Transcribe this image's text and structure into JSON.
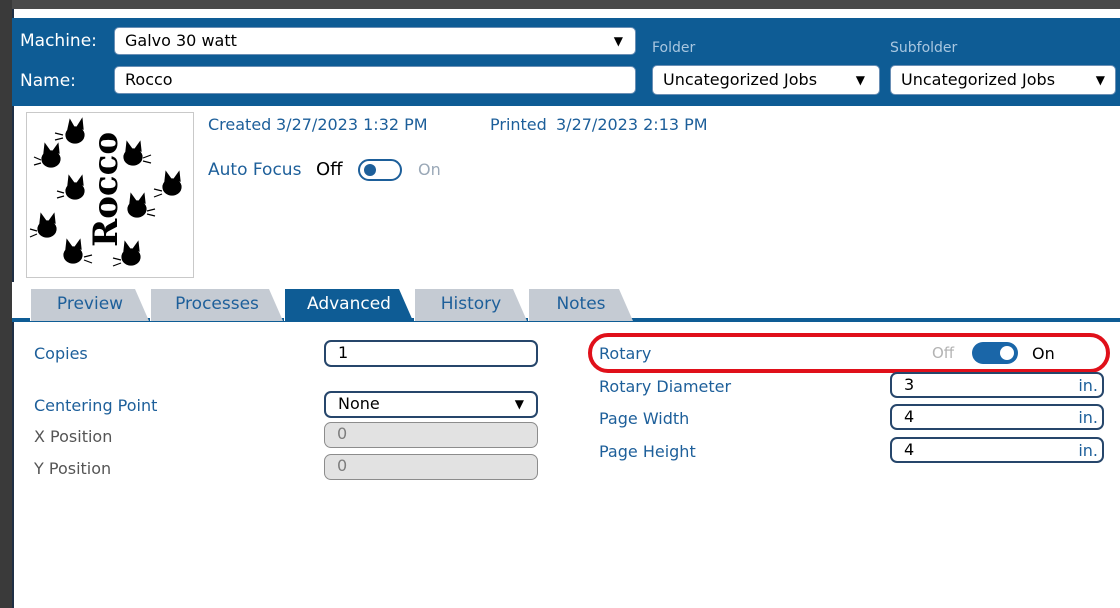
{
  "header": {
    "machine_label": "Machine:",
    "machine_value": "Galvo 30 watt",
    "name_label": "Name:",
    "name_value": "Rocco",
    "folder_label": "Folder",
    "folder_value": "Uncategorized Jobs",
    "subfolder_label": "Subfolder",
    "subfolder_value": "Uncategorized Jobs"
  },
  "info": {
    "created_label": "Created",
    "created_value": "3/27/2023 1:32 PM",
    "printed_label": "Printed",
    "printed_value": "3/27/2023 2:13 PM",
    "autofocus_label": "Auto Focus",
    "autofocus_off": "Off",
    "autofocus_on": "On",
    "autofocus_state": "off"
  },
  "thumbnail": {
    "text": "Rocco"
  },
  "tabs": [
    {
      "label": "Preview",
      "active": false
    },
    {
      "label": "Processes",
      "active": false
    },
    {
      "label": "Advanced",
      "active": true
    },
    {
      "label": "History",
      "active": false
    },
    {
      "label": "Notes",
      "active": false
    }
  ],
  "advanced": {
    "copies_label": "Copies",
    "copies_value": "1",
    "centering_label": "Centering Point",
    "centering_value": "None",
    "xpos_label": "X Position",
    "xpos_value": "0",
    "ypos_label": "Y Position",
    "ypos_value": "0",
    "rotary_label": "Rotary",
    "rotary_off": "Off",
    "rotary_on": "On",
    "rotary_state": "on",
    "rotary_diameter_label": "Rotary Diameter",
    "rotary_diameter_value": "3",
    "page_width_label": "Page Width",
    "page_width_value": "4",
    "page_height_label": "Page Height",
    "page_height_value": "4",
    "unit": "in."
  },
  "colors": {
    "header_bg": "#0e5c95",
    "accent": "#1d5f9a",
    "highlight": "#e0101a"
  }
}
